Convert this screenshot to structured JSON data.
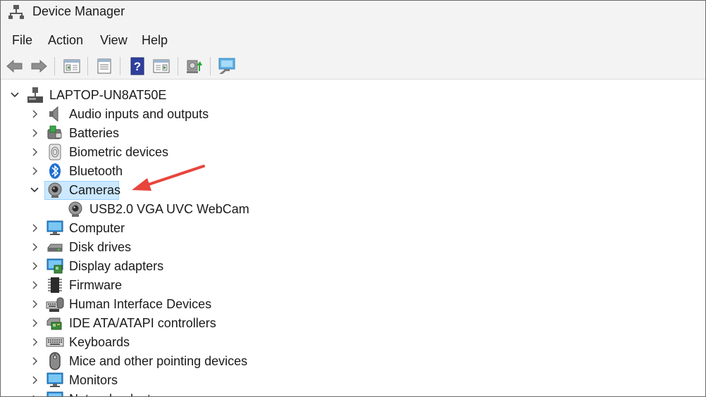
{
  "window": {
    "title": "Device Manager"
  },
  "menu": [
    "File",
    "Action",
    "View",
    "Help"
  ],
  "toolbar": {
    "buttons": [
      "back-icon",
      "forward-icon",
      "properties-panel-icon",
      "device-list-icon",
      "help-icon",
      "view-panel-icon",
      "scan-hardware-icon",
      "monitor-icon"
    ]
  },
  "tree": {
    "root": "LAPTOP-UN8AT50E",
    "items": [
      {
        "label": "Audio inputs and outputs",
        "icon": "speaker-icon",
        "expanded": false
      },
      {
        "label": "Batteries",
        "icon": "battery-icon",
        "expanded": false
      },
      {
        "label": "Biometric devices",
        "icon": "fingerprint-icon",
        "expanded": false
      },
      {
        "label": "Bluetooth",
        "icon": "bluetooth-icon",
        "expanded": false
      },
      {
        "label": "Cameras",
        "icon": "camera-icon",
        "expanded": true,
        "selected": true
      },
      {
        "label": "USB2.0 VGA UVC WebCam",
        "icon": "webcam-icon",
        "child": true
      },
      {
        "label": "Computer",
        "icon": "computer-icon",
        "expanded": false
      },
      {
        "label": "Disk drives",
        "icon": "disk-drive-icon",
        "expanded": false
      },
      {
        "label": "Display adapters",
        "icon": "display-adapter-icon",
        "expanded": false
      },
      {
        "label": "Firmware",
        "icon": "firmware-chip-icon",
        "expanded": false
      },
      {
        "label": "Human Interface Devices",
        "icon": "hid-icon",
        "expanded": false
      },
      {
        "label": "IDE ATA/ATAPI controllers",
        "icon": "ide-controller-icon",
        "expanded": false
      },
      {
        "label": "Keyboards",
        "icon": "keyboard-icon",
        "expanded": false
      },
      {
        "label": "Mice and other pointing devices",
        "icon": "mouse-icon",
        "expanded": false
      },
      {
        "label": "Monitors",
        "icon": "monitor-icon",
        "expanded": false
      },
      {
        "label": "Network adapters",
        "icon": "network-adapter-icon",
        "expanded": false
      }
    ]
  },
  "annotation": {
    "arrow_color": "#e8453c"
  }
}
